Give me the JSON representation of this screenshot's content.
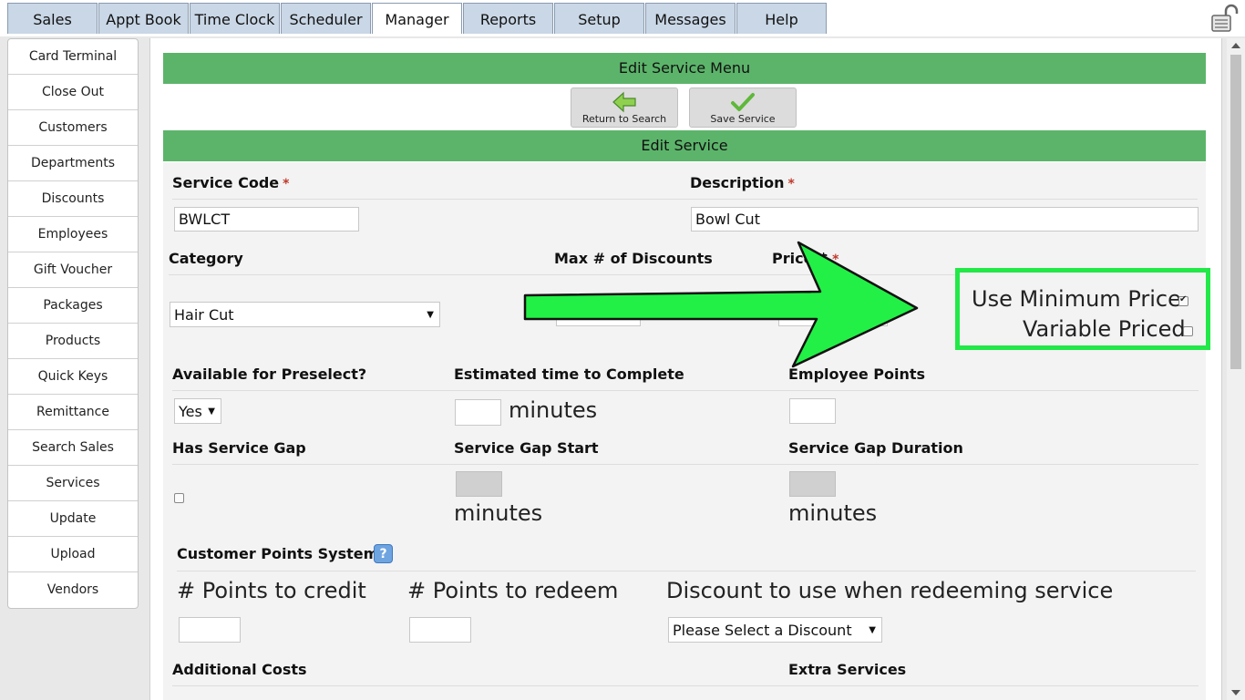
{
  "tabs": [
    "Sales",
    "Appt Book",
    "Time Clock",
    "Scheduler",
    "Manager",
    "Reports",
    "Setup",
    "Messages",
    "Help"
  ],
  "active_tab": "Manager",
  "sidebar": {
    "items": [
      "Card Terminal",
      "Close Out",
      "Customers",
      "Departments",
      "Discounts",
      "Employees",
      "Gift Voucher",
      "Packages",
      "Products",
      "Quick Keys",
      "Remittance",
      "Search Sales",
      "Services",
      "Update",
      "Upload",
      "Vendors"
    ]
  },
  "header": {
    "menu_title": "Edit Service Menu",
    "section_title": "Edit Service"
  },
  "actions": {
    "return_label": "Return to Search",
    "save_label": "Save Service"
  },
  "form": {
    "service_code_label": "Service Code",
    "service_code_value": "BWLCT",
    "description_label": "Description",
    "description_value": "Bowl Cut",
    "required_mark": "*",
    "category_label": "Category",
    "category_value": "Hair Cut",
    "max_discounts_label": "Max # of Discounts",
    "price_label": "Price $",
    "use_min_price_label": "Use Minimum Price",
    "use_min_price_checked": true,
    "variable_priced_label": "Variable Priced",
    "variable_priced_checked": false,
    "preselect_label": "Available for Preselect?",
    "preselect_value": "Yes",
    "est_time_label": "Estimated time to Complete",
    "minutes": "minutes",
    "employee_points_label": "Employee Points",
    "service_gap_label": "Has Service Gap",
    "gap_start_label": "Service Gap Start",
    "gap_duration_label": "Service Gap Duration",
    "points_system_label": "Customer Points System",
    "points_credit_label": "# Points to credit",
    "points_redeem_label": "# Points to redeem",
    "discount_redeem_label": "Discount to use when redeeming service",
    "discount_redeem_value": "Please Select a Discount",
    "additional_costs_label": "Additional Costs",
    "extra_services_label": "Extra Services"
  },
  "colors": {
    "green_bar": "#5cb46a",
    "highlight": "#22e848",
    "tab_bg": "#c9d7e6"
  }
}
